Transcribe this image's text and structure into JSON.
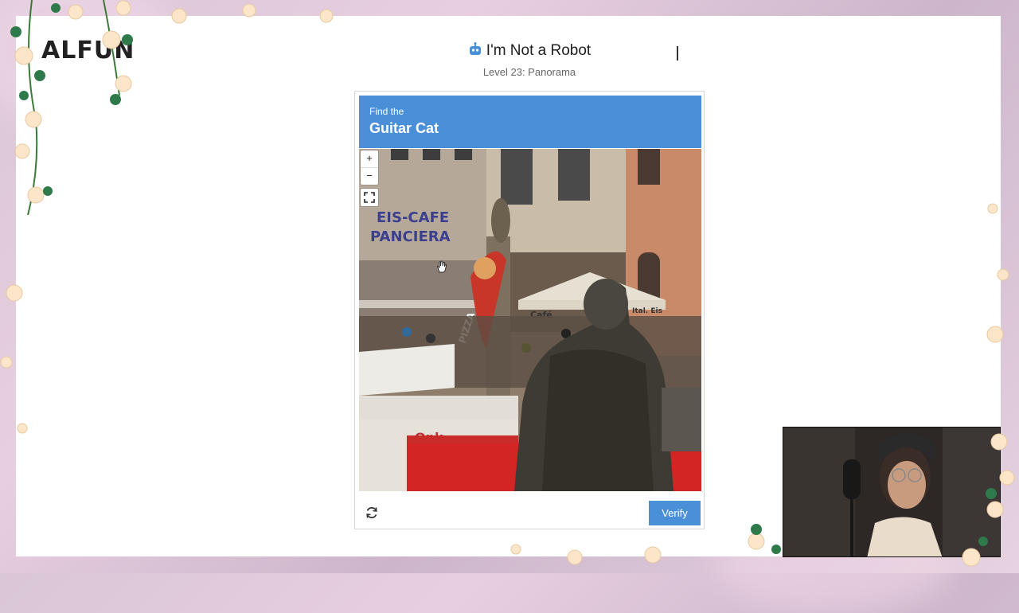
{
  "brand": {
    "logo_text": "ALFUN"
  },
  "game": {
    "title": "I'm Not a Robot",
    "level": "Level 23: Panorama"
  },
  "captcha": {
    "prompt": "Find the",
    "target": "Guitar Cat",
    "scene_signs": {
      "cafe_name_1": "EIS-CAFE",
      "cafe_name_2": "PANCIERA",
      "umbrella": "Café",
      "umbrella_2": "Ital. Eis",
      "flag": "PIZZA"
    },
    "zoom_in": "+",
    "zoom_out": "−",
    "verify_label": "Verify"
  },
  "icons": {
    "robot": "robot-icon",
    "refresh": "refresh-icon",
    "fullscreen": "fullscreen-icon",
    "cursor": "hand-cursor-icon"
  },
  "colors": {
    "accent": "#4a90d9",
    "page_bg": "#ffffff"
  }
}
